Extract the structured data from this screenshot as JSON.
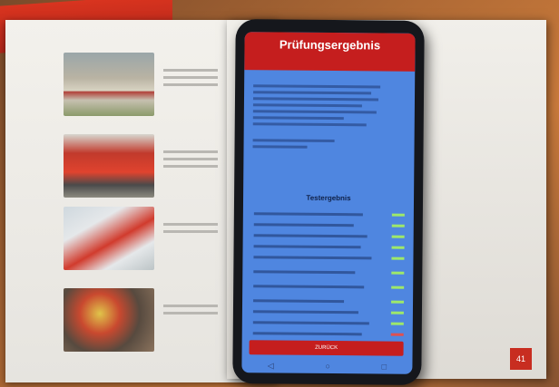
{
  "app": {
    "title": "Prüfungsergebnis",
    "results_heading": "Testergebnis",
    "back_button_label": "ZURÜCK"
  },
  "book": {
    "page_number": "41"
  },
  "result_rows": [
    {
      "status": "pass"
    },
    {
      "status": "pass"
    },
    {
      "status": "pass"
    },
    {
      "status": "pass"
    },
    {
      "status": "pass"
    },
    {
      "status": "pass"
    },
    {
      "status": "pass"
    },
    {
      "status": "pass"
    },
    {
      "status": "pass"
    },
    {
      "status": "pass"
    },
    {
      "status": "fail"
    }
  ],
  "navbar": {
    "back_icon": "◁",
    "home_icon": "○",
    "recent_icon": "□"
  },
  "colors": {
    "app_bar": "#c51e1e",
    "screen_background": "#4f86e0",
    "pass": "#9ee86a",
    "fail": "#e05050"
  }
}
